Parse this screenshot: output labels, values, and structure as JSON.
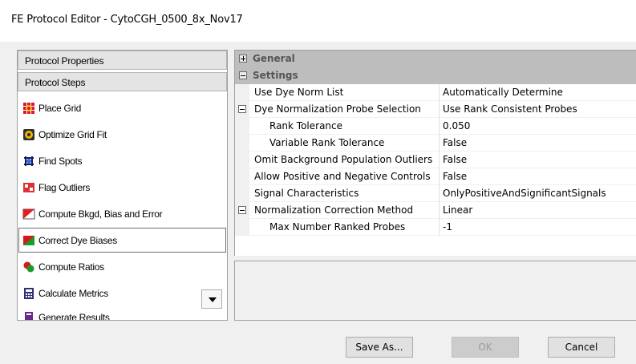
{
  "window": {
    "title": "FE Protocol Editor - CytoCGH_0500_8x_Nov17"
  },
  "left_panel": {
    "protocol_properties_label": "Protocol Properties",
    "protocol_steps_label": "Protocol Steps",
    "steps": [
      {
        "label": "Place Grid",
        "icon": "place-grid-icon"
      },
      {
        "label": "Optimize Grid Fit",
        "icon": "optimize-grid-icon"
      },
      {
        "label": "Find Spots",
        "icon": "find-spots-icon"
      },
      {
        "label": "Flag Outliers",
        "icon": "flag-outliers-icon"
      },
      {
        "label": "Compute Bkgd, Bias and Error",
        "icon": "compute-bkgd-icon"
      },
      {
        "label": "Correct Dye Biases",
        "icon": "correct-dye-icon",
        "selected": true
      },
      {
        "label": "Compute Ratios",
        "icon": "compute-ratios-icon"
      },
      {
        "label": "Calculate Metrics",
        "icon": "calculate-metrics-icon"
      },
      {
        "label": "Generate Results",
        "icon": "generate-results-icon"
      }
    ]
  },
  "property_grid": {
    "categories": {
      "general": "General",
      "settings": "Settings"
    },
    "rows": [
      {
        "name": "Use Dye Norm List",
        "value": "Automatically Determine"
      },
      {
        "name": "Dye Normalization Probe Selection",
        "value": "Use Rank Consistent Probes"
      },
      {
        "name": "Rank Tolerance",
        "value": "0.050"
      },
      {
        "name": "Variable Rank Tolerance",
        "value": "False"
      },
      {
        "name": "Omit Background Population Outliers",
        "value": "False"
      },
      {
        "name": "Allow Positive and Negative Controls",
        "value": "False"
      },
      {
        "name": "Signal Characteristics",
        "value": "OnlyPositiveAndSignificantSignals"
      },
      {
        "name": "Normalization Correction Method",
        "value": "Linear"
      },
      {
        "name": "Max Number Ranked Probes",
        "value": "-1"
      }
    ]
  },
  "buttons": {
    "save_as": "Save As...",
    "ok": "OK",
    "cancel": "Cancel"
  }
}
